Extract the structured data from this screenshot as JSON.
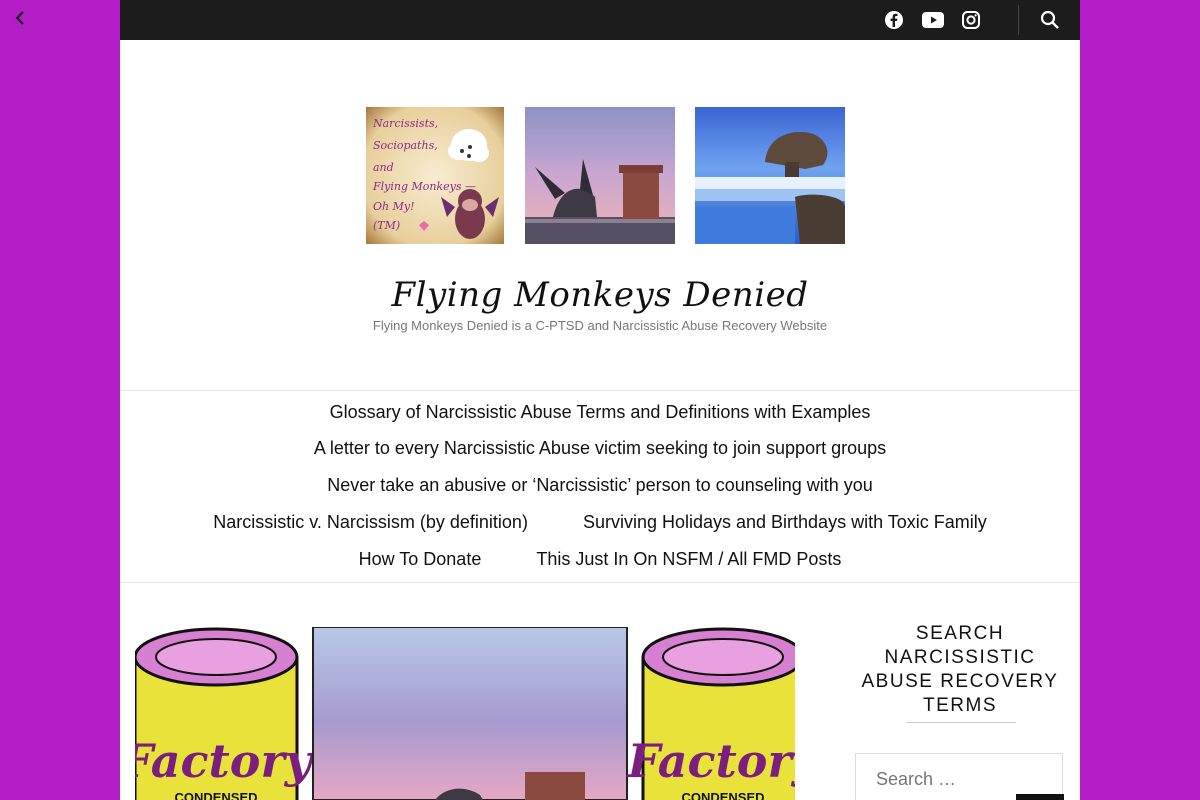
{
  "topbar": {
    "social": [
      "facebook-icon",
      "youtube-icon",
      "instagram-icon"
    ],
    "search_icon": "search-icon"
  },
  "header": {
    "image1_text": [
      "Narcissists,",
      "Sociopaths,",
      "and",
      "Flying Monkeys —",
      "Oh My!",
      "(TM)"
    ]
  },
  "site": {
    "title": "Flying Monkeys Denied",
    "tagline": "Flying Monkeys Denied is a C-PTSD and Narcissistic Abuse Recovery Website"
  },
  "nav": {
    "items": [
      "Glossary of Narcissistic Abuse Terms and Definitions with Examples",
      "A letter to every Narcissistic Abuse victim seeking to join support groups",
      "Never take an abusive or ‘Narcissistic’ person to counseling with you",
      "Narcissistic v. Narcissism (by definition)",
      "Surviving Holidays and Birthdays with Toxic Family",
      "How To Donate",
      "This Just In On NSFM / All FMD Posts"
    ]
  },
  "featured": {
    "can_label": "Factory",
    "can_sub": "CONDENSED"
  },
  "sidebar": {
    "title": "SEARCH NARCISSISTIC ABUSE RECOVERY TERMS",
    "search_placeholder": "Search …"
  },
  "colors": {
    "background": "#b31ec7",
    "topbar": "#1c1c1c"
  }
}
